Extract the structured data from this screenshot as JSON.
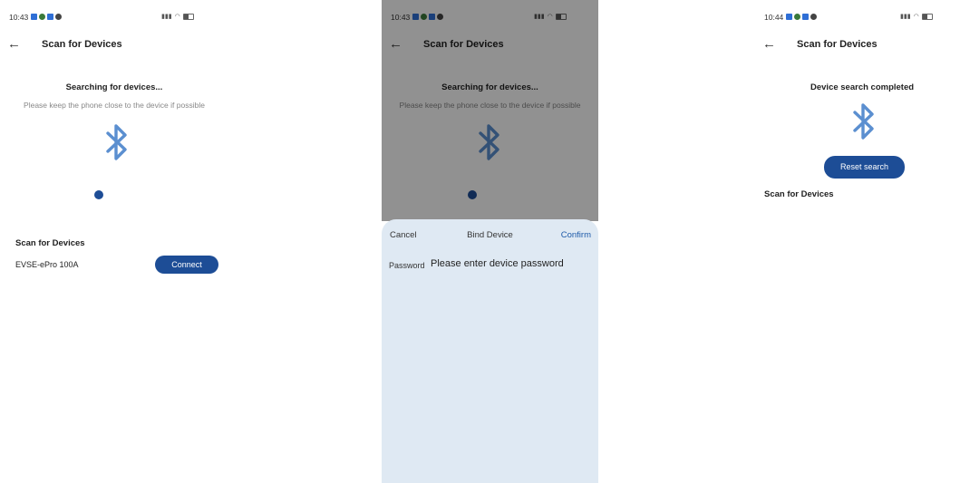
{
  "colors": {
    "accent": "#1d4d96",
    "bluetooth": "#5b8fd0",
    "confirm": "#1d5aa8",
    "sheet": "#dfe9f3"
  },
  "screen1": {
    "status": {
      "time": "10:43"
    },
    "appbar": {
      "back_icon": "arrow-left-icon",
      "title": "Scan for Devices"
    },
    "searching_text": "Searching for devices...",
    "hint_text": "Please keep the phone close to the device if possible",
    "bluetooth_icon": "bluetooth-icon",
    "section_title": "Scan for Devices",
    "devices": [
      {
        "name": "EVSE-ePro 100A",
        "action_label": "Connect"
      }
    ]
  },
  "screen2": {
    "status": {
      "time": "10:43"
    },
    "appbar": {
      "back_icon": "arrow-left-icon",
      "title": "Scan for Devices"
    },
    "searching_text": "Searching for devices...",
    "hint_text": "Please keep the phone close to the device if possible",
    "dialog": {
      "cancel_label": "Cancel",
      "title": "Bind Device",
      "confirm_label": "Confirm",
      "password_label": "Password",
      "password_placeholder": "Please enter device password",
      "password_value": ""
    }
  },
  "screen3": {
    "status": {
      "time": "10:44"
    },
    "appbar": {
      "back_icon": "arrow-left-icon",
      "title": "Scan for Devices"
    },
    "completed_text": "Device search completed",
    "reset_label": "Reset search",
    "section_title": "Scan for Devices"
  }
}
